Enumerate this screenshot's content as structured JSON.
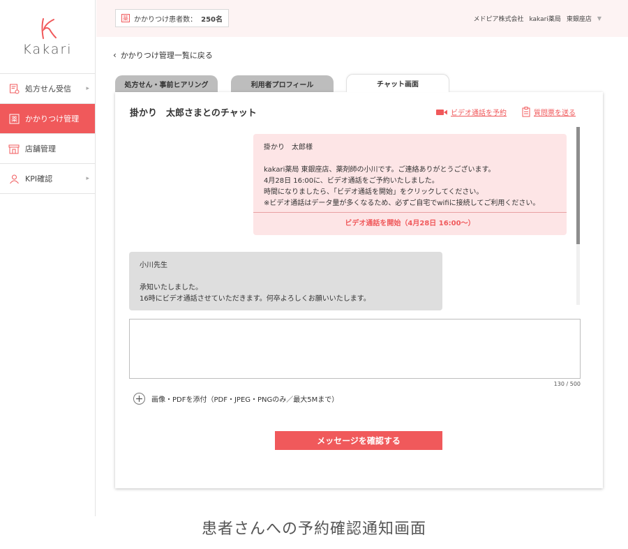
{
  "brand": {
    "logo_text": "Kakari",
    "accent": "#f0595b"
  },
  "sidebar": {
    "items": [
      {
        "label": "処方せん受信",
        "icon": "prescription-icon",
        "has_chevron": true,
        "active": false
      },
      {
        "label": "かかりつけ管理",
        "icon": "pharmacy-kanji-icon",
        "has_chevron": false,
        "active": true
      },
      {
        "label": "店舗管理",
        "icon": "store-icon",
        "has_chevron": false,
        "active": false
      },
      {
        "label": "KPI確認",
        "icon": "person-icon",
        "has_chevron": true,
        "active": false
      }
    ]
  },
  "header": {
    "patient_count_label": "かかりつけ患者数：",
    "patient_count_value": "250名",
    "company": "メドピア株式会社",
    "pharmacy": "kakari薬局",
    "store": "東銀座店"
  },
  "back_link": "かかりつけ管理一覧に戻る",
  "tabs": [
    {
      "label": "処方せん・事前ヒアリング",
      "active": false
    },
    {
      "label": "利用者プロフィール",
      "active": false
    },
    {
      "label": "チャット画面",
      "active": true
    }
  ],
  "chat": {
    "title": "掛かり　太郎さまとのチャット",
    "video_reserve_link": "ビデオ通話を予約",
    "questionnaire_link": "質問票を送る",
    "pharmacist_message": {
      "lines": [
        "掛かり　太郎様",
        "",
        "kakari薬局 東銀座店、薬剤師の小川です。ご連絡ありがとうございます。",
        "4月28日 16:00に、ビデオ通話をご予約いたしました。",
        "時間になりましたら、「ビデオ通話を開始」をクリックしてください。",
        "※ビデオ通話はデータ量が多くなるため、必ずご自宅でwifiに接続してご利用ください。"
      ],
      "cta": "ビデオ通話を開始（4月28日 16:00〜）"
    },
    "user_message": {
      "lines": [
        "小川先生",
        "",
        "承知いたしました。",
        "16時にビデオ通話させていただきます。何卒よろしくお願いいたします。"
      ]
    },
    "input_value": "",
    "char_counter": "130 / 500",
    "attach_label": "画像・PDFを添付（PDF・JPEG・PNGのみ／最大5Mまで）",
    "confirm_button": "メッセージを確認する"
  },
  "caption": "患者さんへの予約確認通知画面"
}
